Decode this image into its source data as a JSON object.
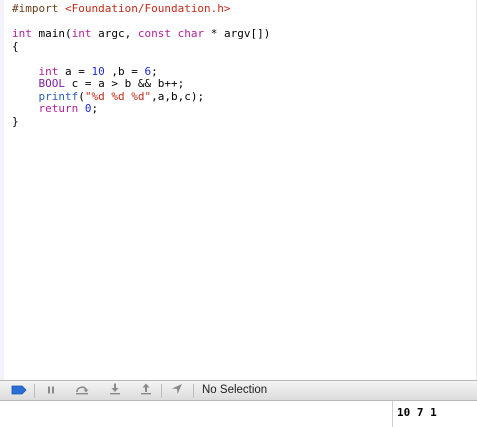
{
  "editor": {
    "lines": [
      [
        {
          "t": "#import ",
          "c": "pre"
        },
        {
          "t": "<Foundation/Foundation.h>",
          "c": "inc"
        }
      ],
      [],
      [
        {
          "t": "int",
          "c": "kw"
        },
        {
          "t": " main(",
          "c": ""
        },
        {
          "t": "int",
          "c": "kw"
        },
        {
          "t": " argc, ",
          "c": ""
        },
        {
          "t": "const",
          "c": "kw"
        },
        {
          "t": " ",
          "c": ""
        },
        {
          "t": "char",
          "c": "kw"
        },
        {
          "t": " * argv[])",
          "c": ""
        }
      ],
      [
        {
          "t": "{",
          "c": ""
        }
      ],
      [],
      [
        {
          "t": "    ",
          "c": ""
        },
        {
          "t": "int",
          "c": "kw"
        },
        {
          "t": " a = ",
          "c": ""
        },
        {
          "t": "10",
          "c": "num"
        },
        {
          "t": " ,b = ",
          "c": ""
        },
        {
          "t": "6",
          "c": "num"
        },
        {
          "t": ";",
          "c": ""
        }
      ],
      [
        {
          "t": "    ",
          "c": ""
        },
        {
          "t": "BOOL",
          "c": "type"
        },
        {
          "t": " c = a > b && b++;",
          "c": ""
        }
      ],
      [
        {
          "t": "    ",
          "c": ""
        },
        {
          "t": "printf",
          "c": "fn"
        },
        {
          "t": "(",
          "c": ""
        },
        {
          "t": "\"%d %d %d\"",
          "c": "str"
        },
        {
          "t": ",a,b,c);",
          "c": ""
        }
      ],
      [
        {
          "t": "    ",
          "c": ""
        },
        {
          "t": "return",
          "c": "kw"
        },
        {
          "t": " ",
          "c": ""
        },
        {
          "t": "0",
          "c": "num"
        },
        {
          "t": ";",
          "c": ""
        }
      ],
      [
        {
          "t": "}",
          "c": ""
        }
      ]
    ]
  },
  "debug_bar": {
    "buttons": [
      {
        "name": "breakpoints-toggle-button",
        "icon": "breakpoint-arrow-icon"
      },
      {
        "name": "pause-button",
        "icon": "pause-icon"
      },
      {
        "name": "step-over-button",
        "icon": "step-over-icon"
      },
      {
        "name": "step-into-button",
        "icon": "step-into-icon"
      },
      {
        "name": "step-out-button",
        "icon": "step-out-icon"
      },
      {
        "name": "simulate-location-button",
        "icon": "location-arrow-icon"
      }
    ],
    "selection_label": "No Selection"
  },
  "console": {
    "output": "10 7 1"
  },
  "colors": {
    "breakpoint_accent": "#2a6fd6",
    "icon_gray": "#8a8a8a"
  }
}
